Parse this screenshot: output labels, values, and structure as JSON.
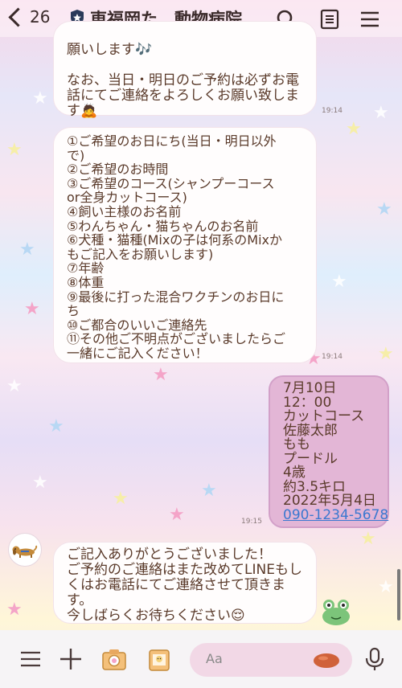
{
  "header": {
    "unread_count": "26",
    "title": "東福岡た…動物病院",
    "icons": [
      "chevron-left-icon",
      "official-badge-icon",
      "search-icon",
      "notes-icon",
      "menu-icon"
    ]
  },
  "messages": [
    {
      "id": "msg1",
      "direction": "received",
      "lines": [
        "願いします🎶",
        "",
        "なお、当日・明日のご予約は必ずお電",
        "話にてご連絡をよろしくお願い致しま",
        "す🙇"
      ],
      "time": "19:14"
    },
    {
      "id": "msg2",
      "direction": "received",
      "lines": [
        "①ご希望のお日にち(当日・明日以外",
        "で)",
        "②ご希望のお時間",
        "③ご希望のコース(シャンプーコース",
        "or全身カットコース)",
        "④飼い主様のお名前",
        "⑤わんちゃん・猫ちゃんのお名前",
        "⑥犬種・猫種(Mixの子は何系のMixか",
        "もご記入をお願いします)",
        "⑦年齢",
        "⑧体重",
        "⑨最後に打った混合ワクチンのお日に",
        "ち",
        "⑩ご都合のいいご連絡先",
        "⑪その他ご不明点がございましたらご",
        "一緒にご記入ください！"
      ],
      "time": "19:14"
    },
    {
      "id": "msg3",
      "direction": "sent",
      "lines": [
        "7月10日",
        "12：00",
        "カットコース",
        "佐藤太郎",
        "もも",
        "プードル",
        "4歳",
        "約3.5キロ",
        "2022年5月4日"
      ],
      "phone": "090-1234-5678",
      "time": "19:15"
    },
    {
      "id": "msg4",
      "direction": "received",
      "lines": [
        "ご記入ありがとうございました！",
        "ご予約のご連絡はまた改めてLINEもし",
        "くはお電話にてご連絡させて頂きま",
        "す。",
        "今しばらくお待ちください😌"
      ]
    }
  ],
  "input": {
    "placeholder": "Aa"
  },
  "colors": {
    "sent_bubble": "#e3b6d6",
    "received_bubble": "#fffdfd",
    "link": "#3a78d0",
    "text": "#5a3a2a"
  }
}
